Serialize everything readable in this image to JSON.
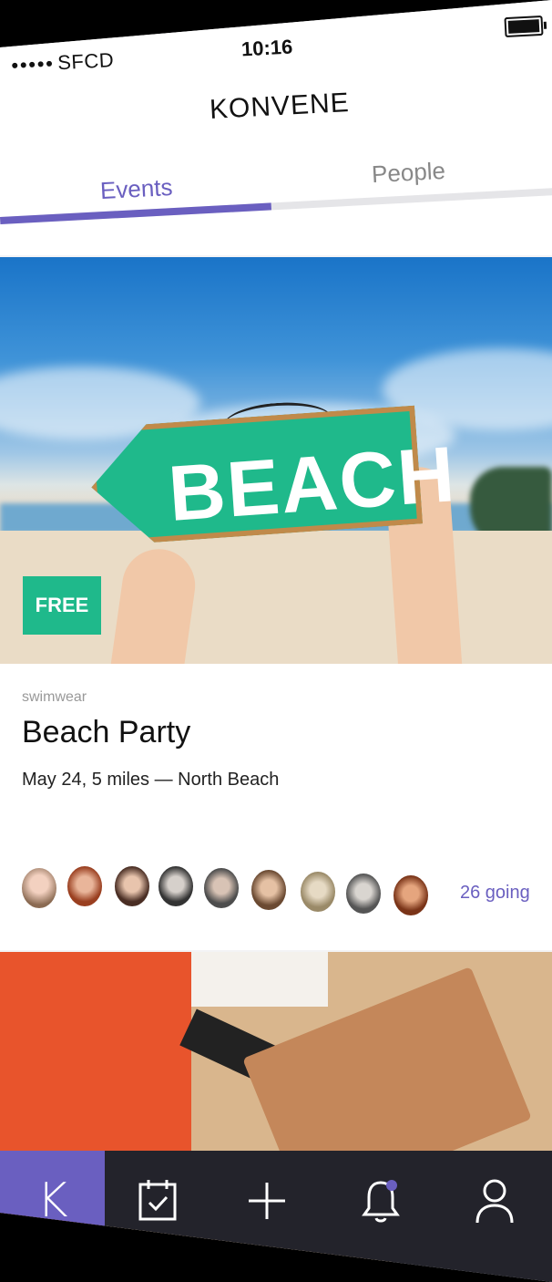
{
  "status_bar": {
    "carrier": "SFCD",
    "signal_dots": "●●●●●",
    "time": "10:16"
  },
  "app": {
    "title": "KONVENE"
  },
  "tabs": [
    {
      "label": "Events",
      "active": true
    },
    {
      "label": "People",
      "active": false
    }
  ],
  "featured_event": {
    "image_sign_text": "BEACH",
    "badge": "FREE",
    "category": "swimwear",
    "title": "Beach Party",
    "details": "May 24, 5 miles — North Beach",
    "going": "26 going",
    "avatar_count": 9
  },
  "bottom_nav": {
    "items": [
      {
        "name": "home",
        "label": "K",
        "icon": "konvene-logo",
        "active": true
      },
      {
        "name": "calendar",
        "icon": "calendar-check-icon"
      },
      {
        "name": "create",
        "icon": "plus-icon"
      },
      {
        "name": "notifications",
        "icon": "bell-icon",
        "has_badge": true
      },
      {
        "name": "profile",
        "icon": "user-icon"
      }
    ]
  },
  "colors": {
    "accent": "#6a5fc0",
    "badge_green": "#1fb98b",
    "nav_background": "#23232b"
  }
}
